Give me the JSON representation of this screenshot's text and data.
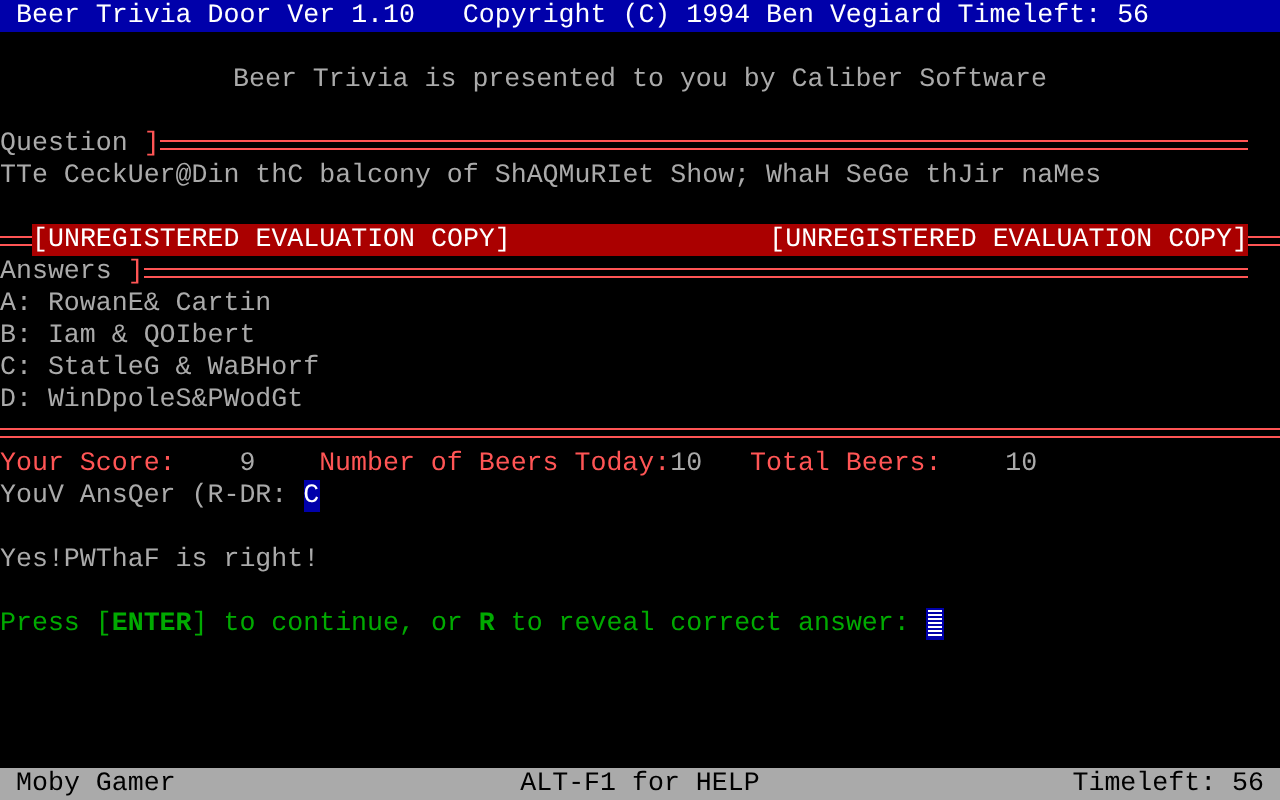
{
  "title_bar": {
    "title": "Beer Trivia Door Ver 1.10   Copyright (C) 1994 Ben Vegiard Timeleft: 56"
  },
  "banner": "Beer Trivia is presented to you by Caliber Software",
  "question": {
    "heading": "Question ]",
    "text": "TTe CeckUer@Din thC balcony of ShAQMuRIet Show; WhaH SeGe thJir naMes"
  },
  "evaluation_bar": {
    "left": "[UNREGISTERED EVALUATION COPY]",
    "right": "[UNREGISTERED EVALUATION COPY]"
  },
  "answers": {
    "heading": "Answers ]",
    "choices": [
      "A: RowanE& Cartin",
      "B: Iam & QOIbert",
      "C: StatleG & WaBHorf",
      "D: WinDpoleS&PWodGt"
    ]
  },
  "stats": [
    {
      "label": "Your Score:",
      "value": "9"
    },
    {
      "label": "Number of Beers Today:",
      "value": "10"
    },
    {
      "label": "Total Beers:",
      "value": "10"
    }
  ],
  "answer_prompt": {
    "label": "YouV AnsQer (R-DR: ",
    "value": "C"
  },
  "result": "Yes!PWThaF is right!",
  "continue_prompt": "Press [**ENTER**] to continue, or **R** to reveal correct answer: ",
  "status_bar": {
    "user": "Moby Gamer",
    "help": "ALT-F1 for HELP",
    "timeleft": "Timeleft: 56"
  }
}
